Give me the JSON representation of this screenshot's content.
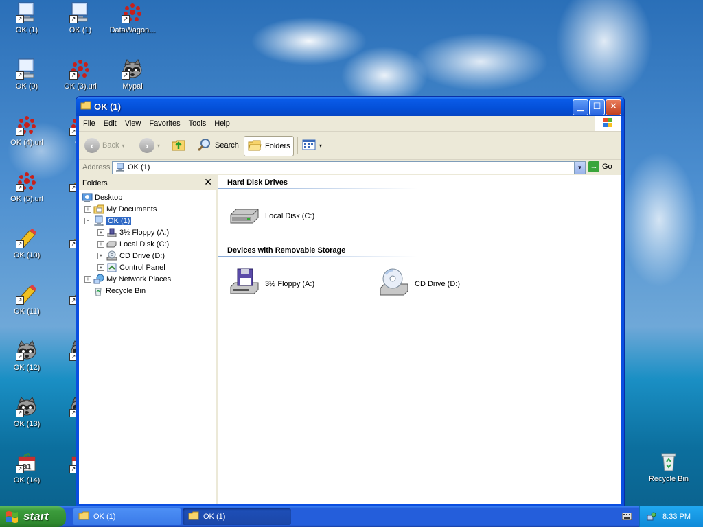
{
  "desktop": {
    "icons_col1": [
      {
        "label": "OK (1)",
        "type": "computer"
      },
      {
        "label": "OK (9)",
        "type": "computer"
      },
      {
        "label": "OK (4).url",
        "type": "web"
      },
      {
        "label": "OK (5).url",
        "type": "web"
      },
      {
        "label": "OK (10)",
        "type": "pencil"
      },
      {
        "label": "OK (11)",
        "type": "pencil"
      },
      {
        "label": "OK (12)",
        "type": "raccoon"
      },
      {
        "label": "OK (13)",
        "type": "raccoon"
      },
      {
        "label": "OK (14)",
        "type": "calendar"
      }
    ],
    "icons_col2": [
      {
        "label": "OK (1)",
        "type": "computer"
      },
      {
        "label": "OK (3).url",
        "type": "web"
      },
      {
        "label": "OK",
        "type": "web"
      },
      {
        "label": "O",
        "type": "pencil"
      },
      {
        "label": "O",
        "type": "pencil"
      },
      {
        "label": "O",
        "type": "pencil"
      },
      {
        "label": "O",
        "type": "raccoon"
      },
      {
        "label": "O",
        "type": "raccoon"
      },
      {
        "label": "O",
        "type": "calendar"
      }
    ],
    "icons_col3": [
      {
        "label": "DataWagon...",
        "type": "web"
      },
      {
        "label": "Mypal",
        "type": "raccoon"
      }
    ],
    "recycle_bin": "Recycle Bin"
  },
  "window": {
    "title": "OK (1)",
    "menu": [
      "File",
      "Edit",
      "View",
      "Favorites",
      "Tools",
      "Help"
    ],
    "toolbar": {
      "back": "Back",
      "search": "Search",
      "folders": "Folders"
    },
    "address": {
      "label": "Address",
      "value": "OK (1)",
      "go": "Go"
    },
    "folders_pane": {
      "title": "Folders",
      "tree": {
        "desktop": "Desktop",
        "my_documents": "My Documents",
        "ok1": "OK (1)",
        "floppy": "3½ Floppy (A:)",
        "local_disk": "Local Disk (C:)",
        "cd_drive": "CD Drive (D:)",
        "control_panel": "Control Panel",
        "network": "My Network Places",
        "recycle": "Recycle Bin"
      }
    },
    "content": {
      "group_hdd": "Hard Disk Drives",
      "local_disk": "Local Disk (C:)",
      "group_removable": "Devices with Removable Storage",
      "floppy": "3½ Floppy (A:)",
      "cd_drive": "CD Drive (D:)"
    }
  },
  "taskbar": {
    "start": "start",
    "tasks": [
      "OK (1)",
      "OK (1)"
    ],
    "clock": "8:33 PM"
  }
}
